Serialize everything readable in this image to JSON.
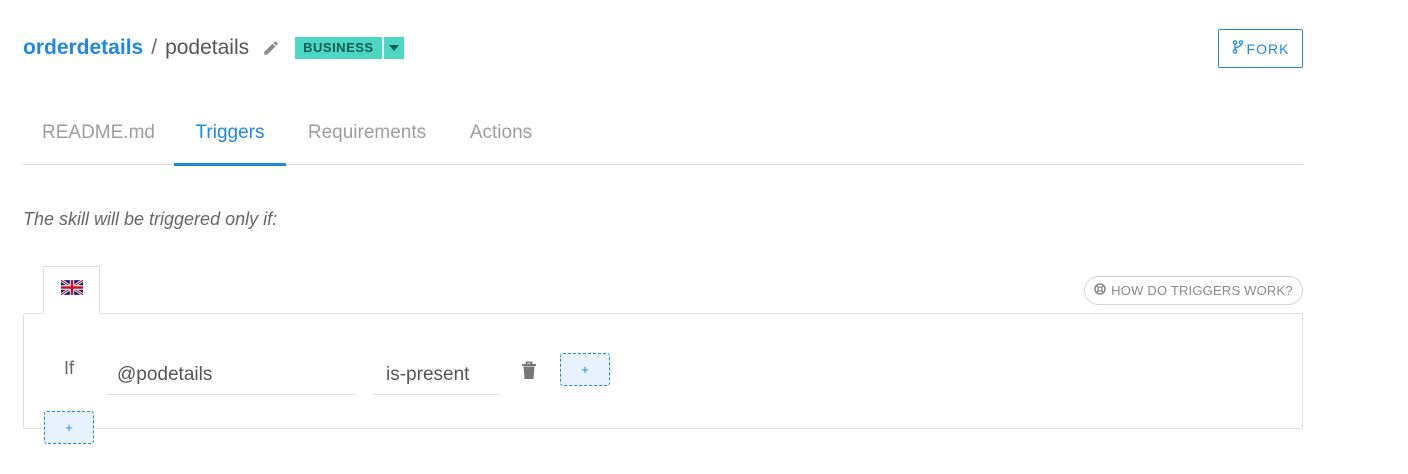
{
  "header": {
    "parent": "orderdetails",
    "separator": "/",
    "child": "podetails",
    "badge": "BUSINESS"
  },
  "fork_button": {
    "label": "FORK"
  },
  "tabs": [
    {
      "label": "README.md",
      "active": false
    },
    {
      "label": "Triggers",
      "active": true
    },
    {
      "label": "Requirements",
      "active": false
    },
    {
      "label": "Actions",
      "active": false
    }
  ],
  "intro_text": "The skill will be triggered only if:",
  "language_tab": {
    "icon": "uk-flag-icon"
  },
  "help_link": {
    "label": "HOW DO TRIGGERS WORK?",
    "icon": "lifebuoy-icon"
  },
  "condition": {
    "if_label": "If",
    "entity": "@podetails",
    "operator": "is-present"
  },
  "add_condition_button": "+",
  "add_group_button": "+",
  "colors": {
    "accent": "#1e88e5",
    "badge_bg": "#4dd6c3",
    "badge_text": "#0d5f55",
    "muted": "#9e9e9e"
  }
}
